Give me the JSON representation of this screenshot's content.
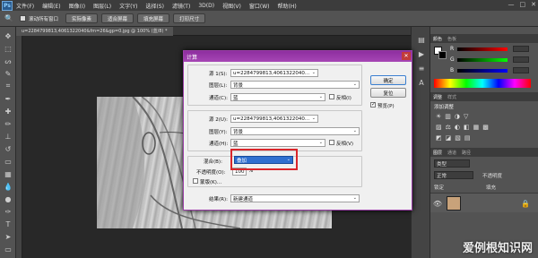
{
  "app": {
    "logo": "Ps"
  },
  "menu": [
    "文件(F)",
    "编辑(E)",
    "图像(I)",
    "图层(L)",
    "文字(Y)",
    "选择(S)",
    "滤镜(T)",
    "3D(D)",
    "视图(V)",
    "窗口(W)",
    "帮助(H)"
  ],
  "options_bar": {
    "scroll_all": "滚动所有窗口",
    "actual_pixels": "实际像素",
    "fit_screen": "适合屏幕",
    "fill_screen": "填充屏幕",
    "print_size": "打印尺寸"
  },
  "document_tab": "u=2284799813,4061322040&fm=26&gp=0.jpg @ 100% (蓝/8) *",
  "panels": {
    "color_tabs": [
      "颜色",
      "色板"
    ],
    "slider_labels": [
      "R",
      "G",
      "B"
    ],
    "adjust_tabs": [
      "调整",
      "样式"
    ],
    "adjust_subtitle": "添加调整",
    "layer_tabs": [
      "图层",
      "通道",
      "路径"
    ],
    "layer_filter": "类型",
    "layer_mode": "正常",
    "layer_lock": "锁定",
    "layer_opacity": "不透明度",
    "layer_fill": "填充"
  },
  "dialog": {
    "title": "计算",
    "close": "✕",
    "source1": {
      "label": "源 1(S):",
      "file": "u=2284799813,4061322040...",
      "layer_label": "图层(L):",
      "layer": "背景",
      "channel_label": "通道(C):",
      "channel": "蓝",
      "invert": "反相(I)"
    },
    "source2": {
      "label": "源 2(U):",
      "file": "u=2284799813,4061322040...",
      "layer_label": "图层(Y):",
      "layer": "背景",
      "channel_label": "通道(H):",
      "channel": "蓝",
      "invert": "反相(V)"
    },
    "blending": {
      "label": "混合(B):",
      "mode": "叠加",
      "opacity_label": "不透明度(O):",
      "opacity": "100",
      "opacity_unit": "%",
      "mask": "蒙版(K)..."
    },
    "result": {
      "label": "结果(R):",
      "value": "新建通道"
    },
    "ok": "确定",
    "reset": "复位",
    "preview": "预览(P)"
  },
  "watermark": "爱例根知识网",
  "colors": {
    "dialog_title": "#9b3aaa",
    "highlight": "#d9262b",
    "selected": "#2f6fd0"
  }
}
